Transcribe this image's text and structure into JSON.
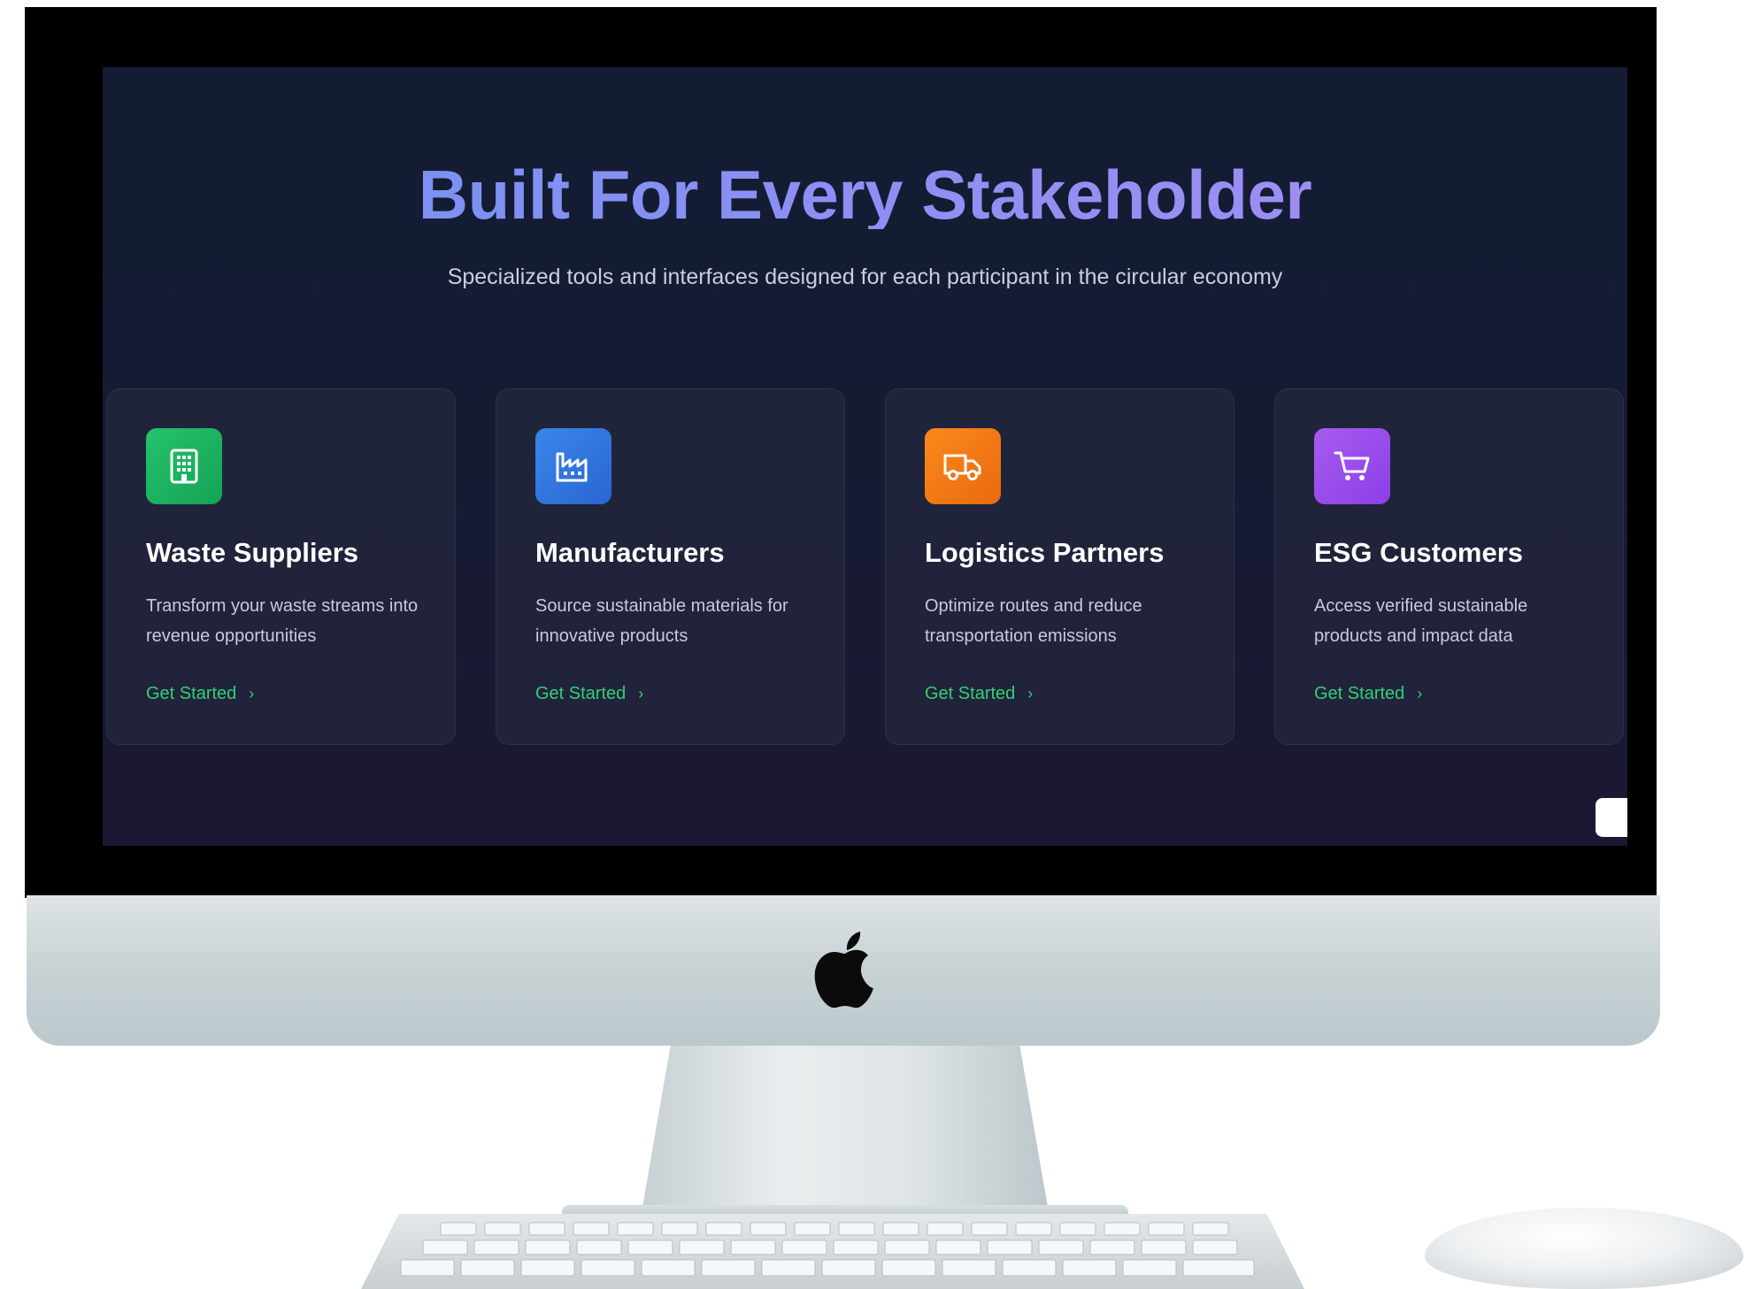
{
  "page": {
    "title": "Built For Every Stakeholder",
    "subtitle": "Specialized tools and interfaces designed for each participant in the circular economy"
  },
  "cards": [
    {
      "title": "Waste Suppliers",
      "description": "Transform your waste streams into revenue opportunities",
      "link": "Get Started",
      "icon": "building-icon",
      "color": "#1db561"
    },
    {
      "title": "Manufacturers",
      "description": "Source sustainable materials for innovative products",
      "link": "Get Started",
      "icon": "factory-icon",
      "color": "#3178e0"
    },
    {
      "title": "Logistics Partners",
      "description": "Optimize routes and reduce transportation emissions",
      "link": "Get Started",
      "icon": "truck-icon",
      "color": "#f47a15"
    },
    {
      "title": "ESG Customers",
      "description": "Access verified sustainable products and impact data",
      "link": "Get Started",
      "icon": "shopping-cart-icon",
      "color": "#9a4deb"
    }
  ],
  "colors": {
    "background": "#151b33",
    "title_gradient": [
      "#6f93f2",
      "#a88df0"
    ],
    "link": "#34cf74"
  }
}
